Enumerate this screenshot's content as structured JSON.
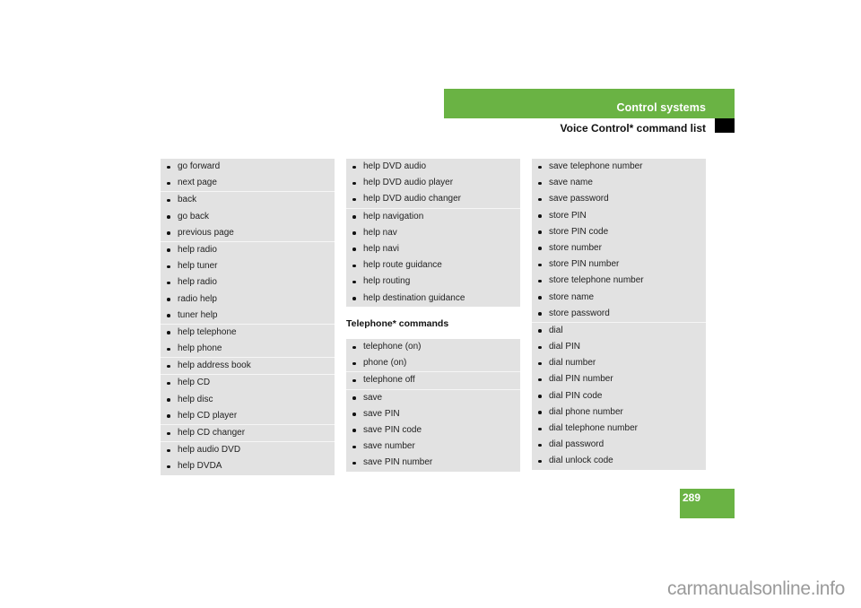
{
  "header": {
    "title": "Control systems",
    "subtitle": "Voice Control* command list"
  },
  "colors": {
    "accent_green": "#6ab344",
    "panel_gray": "#e2e2e2"
  },
  "column1": {
    "groups": [
      [
        "go forward",
        "next page"
      ],
      [
        "back",
        "go back",
        "previous page"
      ],
      [
        "help radio",
        "help tuner",
        "help radio",
        "radio help",
        "tuner help"
      ],
      [
        "help telephone",
        "help phone"
      ],
      [
        "help address book"
      ],
      [
        "help CD",
        "help disc",
        "help CD player"
      ],
      [
        "help CD changer"
      ],
      [
        "help audio DVD",
        "help DVDA"
      ]
    ]
  },
  "column2": {
    "groups": [
      [
        "help DVD audio",
        "help DVD audio player",
        "help DVD audio changer"
      ],
      [
        "help navigation",
        "help nav",
        "help navi",
        "help route guidance",
        "help routing",
        "help destination guidance"
      ]
    ]
  },
  "telephone_section": {
    "heading": "Telephone* commands",
    "groups": [
      [
        "telephone (on)",
        "phone (on)"
      ],
      [
        "telephone off"
      ],
      [
        "save",
        "save PIN",
        "save PIN code",
        "save number",
        "save PIN number"
      ]
    ]
  },
  "column3": {
    "groups": [
      [
        "save telephone number",
        "save name",
        "save password",
        "store PIN",
        "store PIN code",
        "store number",
        "store PIN number",
        "store telephone number",
        "store name",
        "store password"
      ],
      [
        "dial",
        "dial PIN",
        "dial number",
        "dial PIN number",
        "dial PIN code",
        "dial phone number",
        "dial telephone number",
        "dial password",
        "dial unlock code"
      ]
    ]
  },
  "footer": {
    "page_number": "289",
    "watermark": "carmanualsonline.info"
  }
}
